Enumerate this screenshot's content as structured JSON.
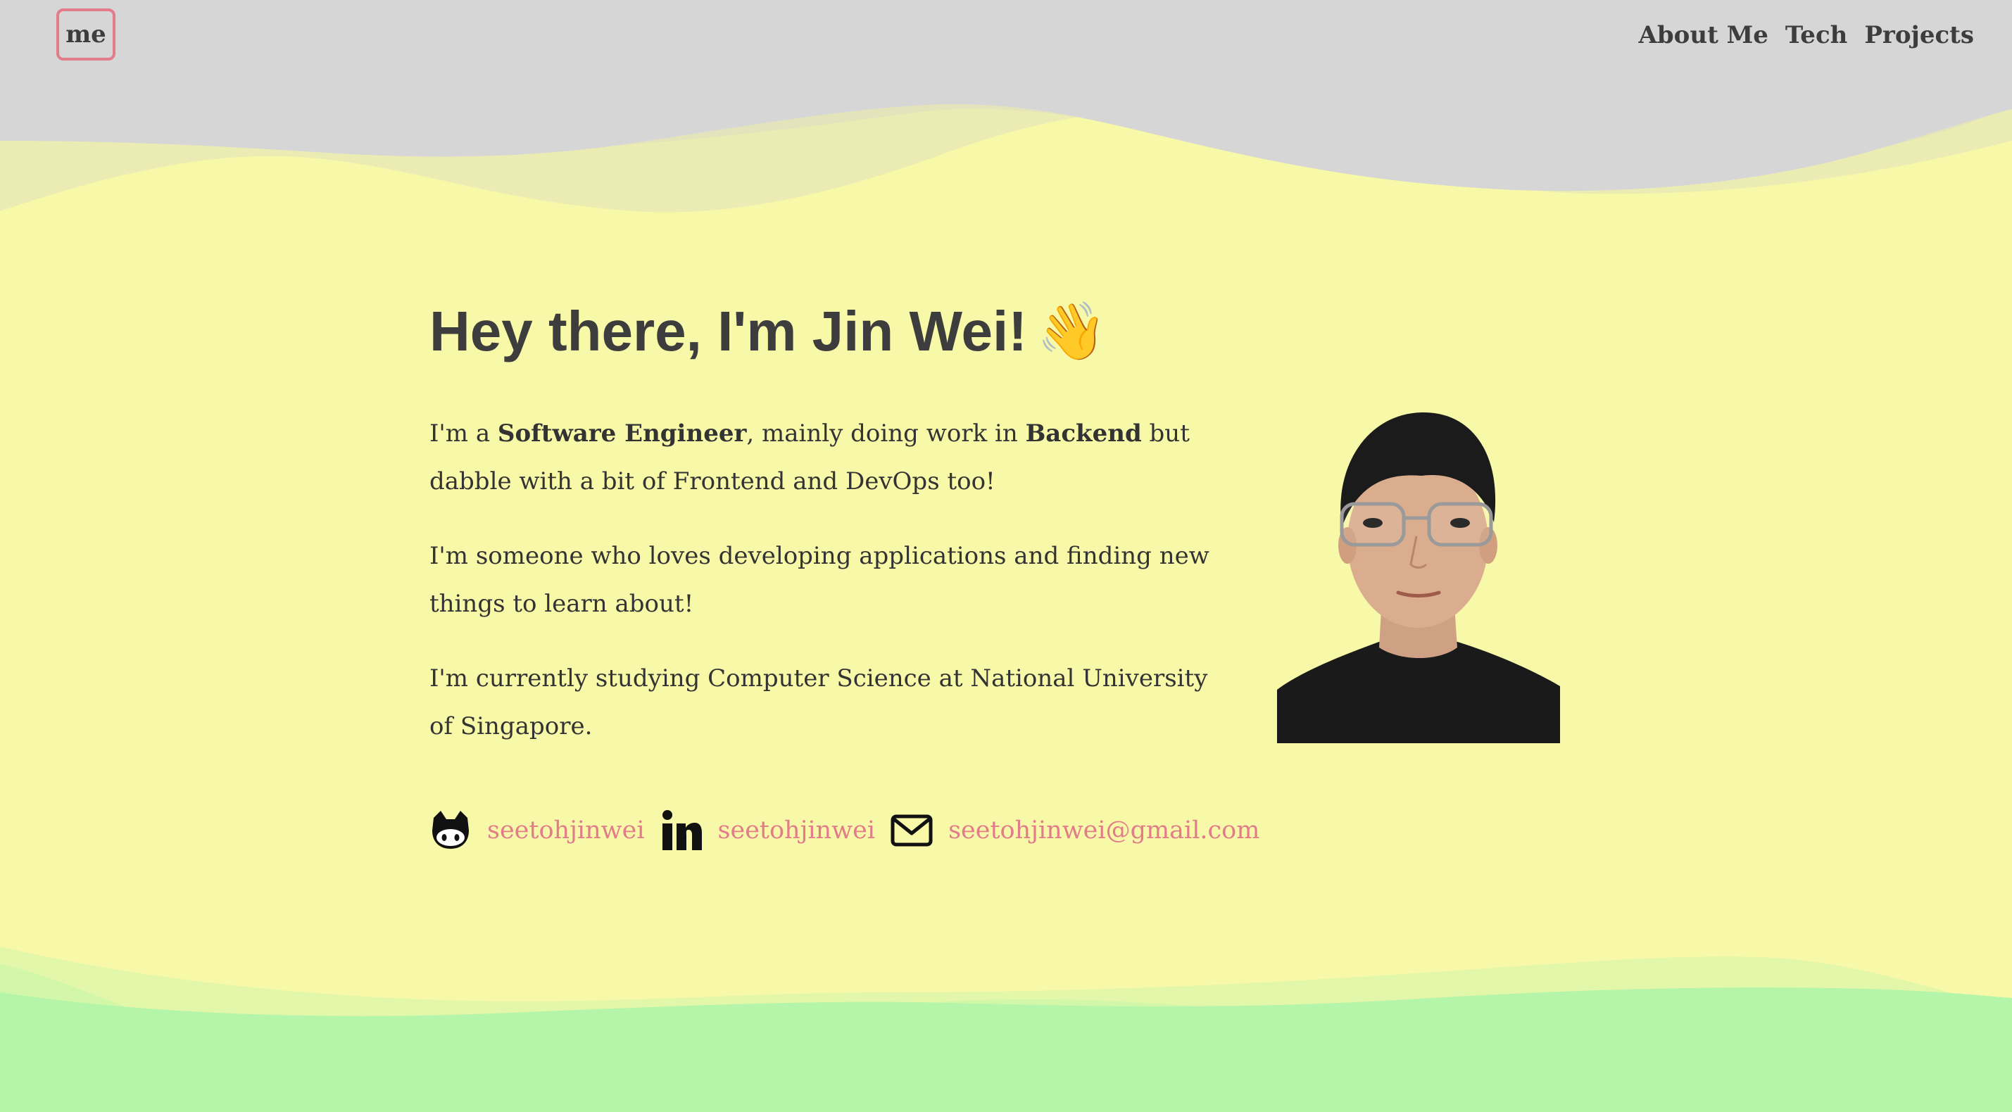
{
  "nav": {
    "logo": "me",
    "links": [
      "About Me",
      "Tech",
      "Projects"
    ]
  },
  "hero": {
    "title": "Hey there, I'm Jin Wei!",
    "emoji": "👋",
    "p1": {
      "before_role": "I'm a ",
      "role": "Software Engineer",
      "middle": ", mainly doing work in ",
      "focus": "Backend",
      "after": " but dabble with a bit of Frontend and DevOps too!"
    },
    "p2": "I'm someone who loves developing applications and finding new things to learn about!",
    "p3": "I'm currently studying Computer Science at National University of Singapore."
  },
  "socials": {
    "github": {
      "icon": "github-icon",
      "label": "seetohjinwei"
    },
    "linkedin": {
      "icon": "linkedin-icon",
      "label": "seetohjinwei"
    },
    "email": {
      "icon": "mail-icon",
      "label": "seetohjinwei@gmail.com"
    }
  },
  "colors": {
    "background": "#f7f8a8",
    "header_wave": "#d6d6d6",
    "footer_wave": "#b5f5a9",
    "accent": "#e27b8a",
    "text": "#3d3d3d"
  }
}
